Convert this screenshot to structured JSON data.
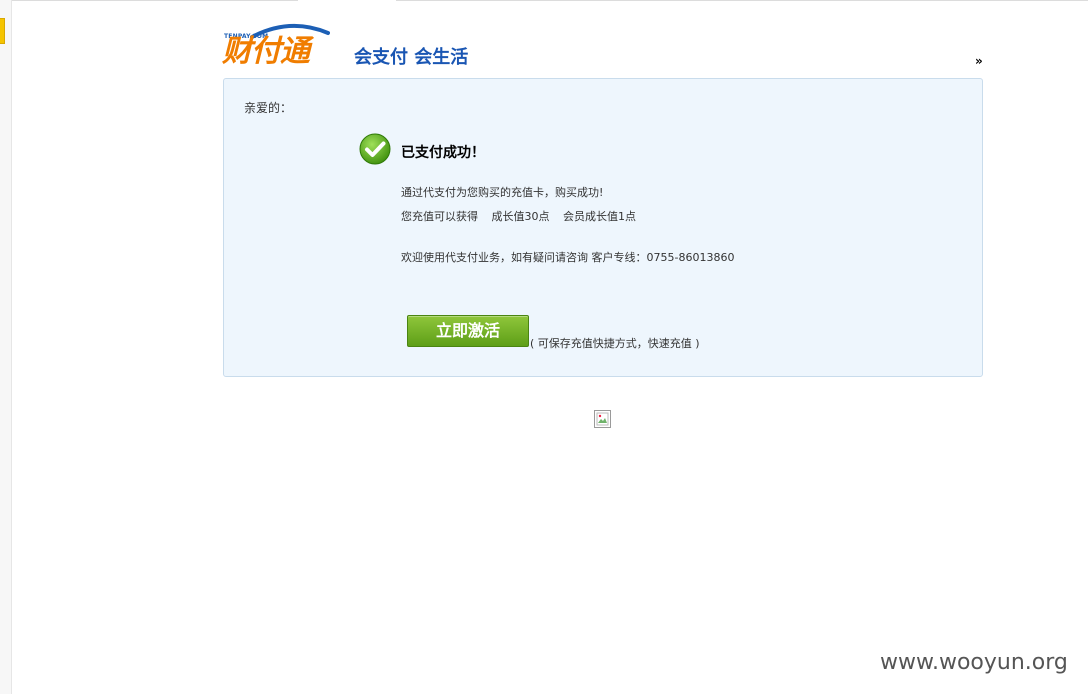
{
  "header": {
    "logo_small": "TENPAY.COM",
    "logo_main": "财付通",
    "slogan": "会支付 会生活",
    "more_arrow": "»"
  },
  "panel": {
    "greeting": "亲爱的：",
    "success_title": "已支付成功！",
    "message_line1": "通过代支付为您购买的充值卡，购买成功!",
    "message_line2": {
      "prefix": "您充值可以获得",
      "growth": "成长值30点",
      "member_growth": "会员成长值1点"
    },
    "help_line": "欢迎使用代支付业务，如有疑问请咨询  客户专线：0755-86013860",
    "activate_button": "立即激活",
    "activate_note": "( 可保存充值快捷方式，快速充值 )"
  },
  "footer": {
    "watermark": "www.wooyun.org"
  },
  "colors": {
    "panel_bg": "#eef6fd",
    "logo_orange": "#f07d00",
    "logo_blue": "#1a56b3",
    "button_green": "#6aa81e"
  },
  "icons": {
    "success": "check-circle-icon",
    "broken_image": "broken-image-icon"
  }
}
